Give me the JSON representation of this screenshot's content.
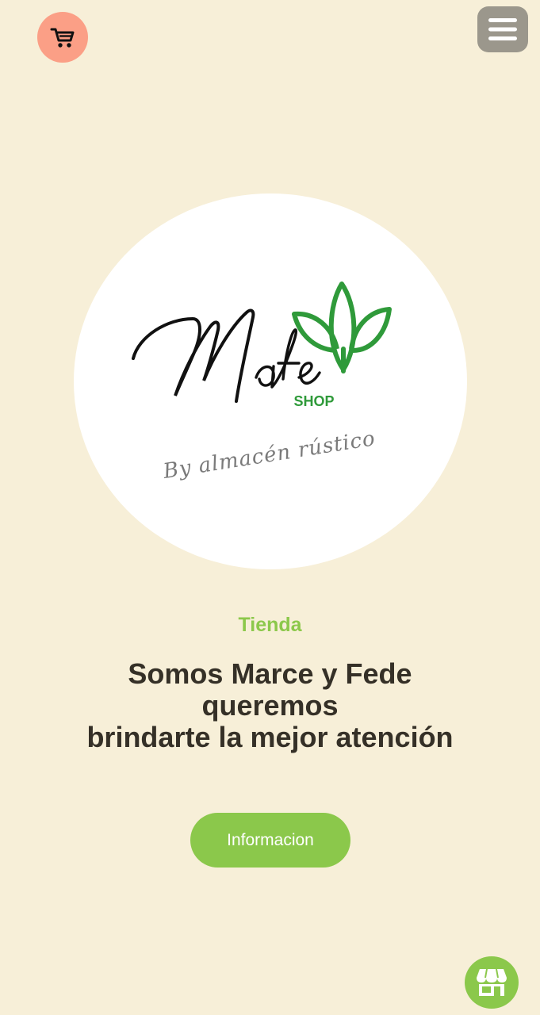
{
  "header": {
    "cart_icon": "cart-icon",
    "menu_icon": "hamburger-menu-icon"
  },
  "logo": {
    "brand_script": "Mafe",
    "shop_label": "SHOP",
    "tagline": "By almacén rústico"
  },
  "hero": {
    "eyebrow": "Tienda",
    "headline_lines": [
      "Somos Marce y Fede",
      "queremos",
      "brindarte la mejor atención"
    ],
    "cta_label": "Informacion"
  },
  "footer": {
    "store_icon": "store-icon"
  },
  "colors": {
    "background": "#f7efd8",
    "accent_green": "#8bc84b",
    "cart_button": "#fb9f86",
    "menu_button": "#9b978c",
    "headline_text": "#353027"
  }
}
